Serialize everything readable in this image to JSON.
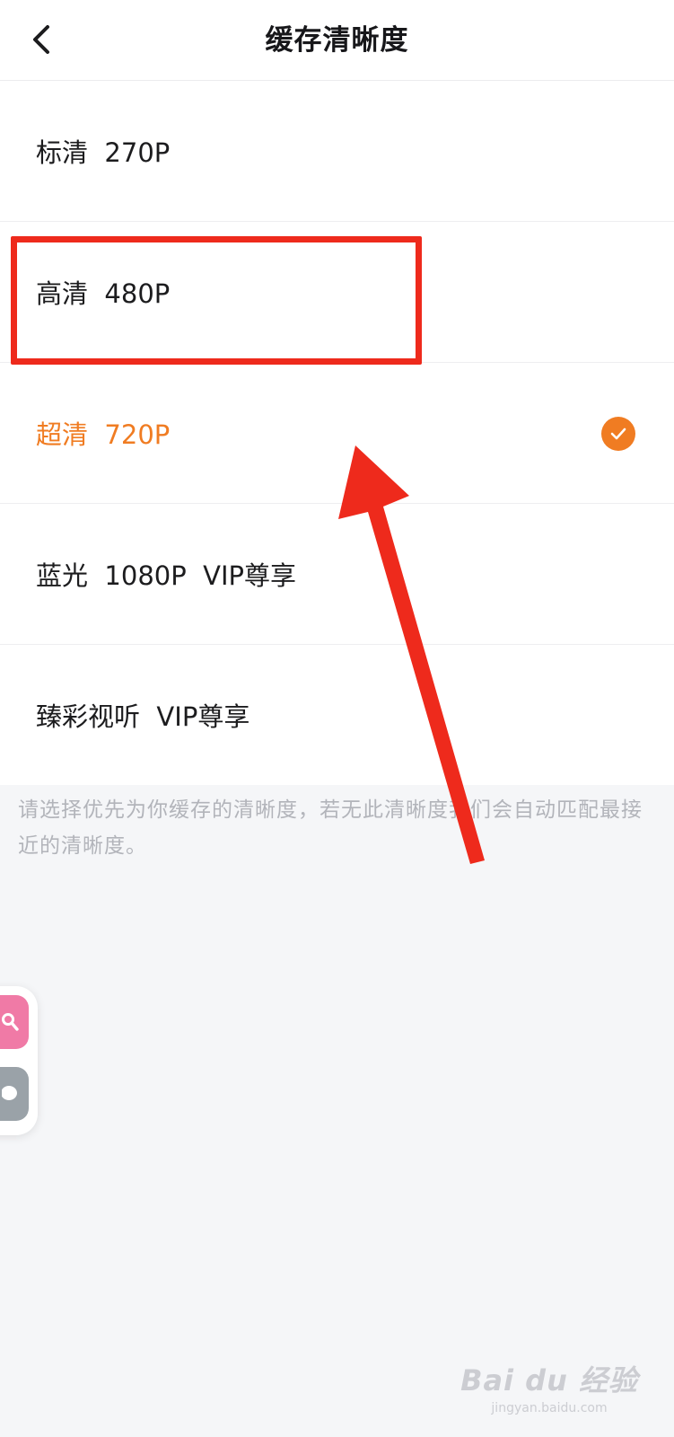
{
  "header": {
    "title": "缓存清晰度",
    "back_icon": "chevron-left-icon"
  },
  "options": [
    {
      "label": "标清  270P"
    },
    {
      "label": "高清  480P"
    },
    {
      "label": "超清  720P",
      "selected": true
    },
    {
      "label": "蓝光  1080P  VIP尊享"
    },
    {
      "label": "臻彩视听  VIP尊享"
    }
  ],
  "hint": "请选择优先为你缓存的清晰度，若无此清晰度我们会自动匹配最接近的清晰度。",
  "floating": {
    "search_icon": "search-icon",
    "chat_icon": "chat-bubble-icon"
  },
  "watermark": {
    "brand": "Bai du 经验",
    "url": "jingyan.baidu.com"
  },
  "colors": {
    "accent": "#f07c22",
    "annotation": "#ee2a1c",
    "hint_text": "#b2b4ba",
    "background": "#f5f6f8"
  }
}
